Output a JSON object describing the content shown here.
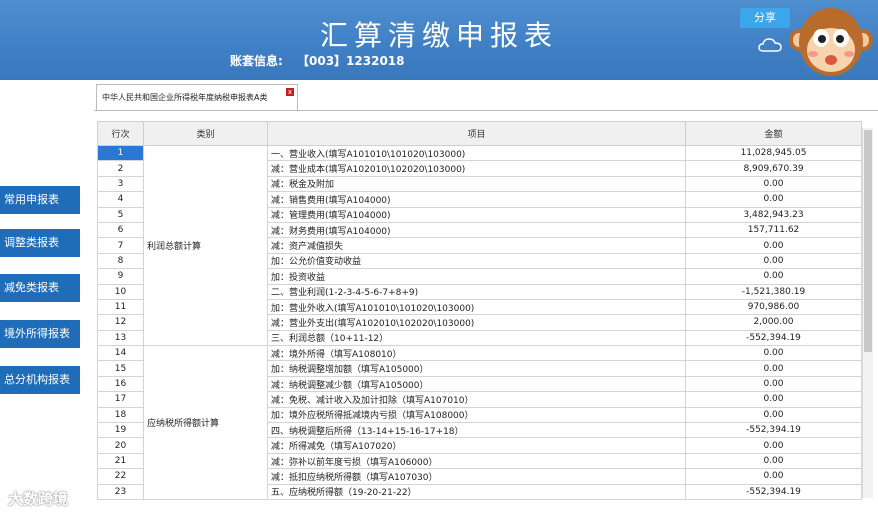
{
  "header": {
    "title": "汇算清缴申报表",
    "account_label": "账套信息:",
    "account_value": "【003】1232018",
    "share_label": "分享"
  },
  "nav": {
    "items": [
      "常用申报表",
      "调整类报表",
      "减免类报表",
      "境外所得报表",
      "总分机构报表"
    ]
  },
  "tab": {
    "label": "中华人民共和国企业所得税年度纳税申报表A类",
    "close": "x"
  },
  "table": {
    "headers": [
      "行次",
      "类别",
      "项目",
      "金额"
    ],
    "categories": [
      "利润总额计算",
      "应纳税所得额计算"
    ],
    "rows": [
      {
        "no": "1",
        "item": "一、营业收入(填写A101010\\101020\\103000)",
        "amount": "11,028,945.05"
      },
      {
        "no": "2",
        "item": "减：营业成本(填写A102010\\102020\\103000)",
        "amount": "8,909,670.39"
      },
      {
        "no": "3",
        "item": "减：税金及附加",
        "amount": "0.00"
      },
      {
        "no": "4",
        "item": "减：销售费用(填写A104000)",
        "amount": "0.00"
      },
      {
        "no": "5",
        "item": "减：管理费用(填写A104000)",
        "amount": "3,482,943.23"
      },
      {
        "no": "6",
        "item": "减：财务费用(填写A104000)",
        "amount": "157,711.62"
      },
      {
        "no": "7",
        "item": "减：资产减值损失",
        "amount": "0.00"
      },
      {
        "no": "8",
        "item": "加：公允价值变动收益",
        "amount": "0.00"
      },
      {
        "no": "9",
        "item": "加：投资收益",
        "amount": "0.00"
      },
      {
        "no": "10",
        "item": "二、营业利润(1-2-3-4-5-6-7+8+9)",
        "amount": "-1,521,380.19"
      },
      {
        "no": "11",
        "item": "加：营业外收入(填写A101010\\101020\\103000)",
        "amount": "970,986.00"
      },
      {
        "no": "12",
        "item": "减：营业外支出(填写A102010\\102020\\103000)",
        "amount": "2,000.00"
      },
      {
        "no": "13",
        "item": "三、利润总额（10+11-12）",
        "amount": "-552,394.19"
      },
      {
        "no": "14",
        "item": "减：境外所得（填写A108010）",
        "amount": "0.00"
      },
      {
        "no": "15",
        "item": "加：纳税调整增加额（填写A105000）",
        "amount": "0.00"
      },
      {
        "no": "16",
        "item": "减：纳税调整减少额（填写A105000）",
        "amount": "0.00"
      },
      {
        "no": "17",
        "item": "减：免税、减计收入及加计扣除（填写A107010）",
        "amount": "0.00"
      },
      {
        "no": "18",
        "item": "加：境外应税所得抵减境内亏损（填写A108000）",
        "amount": "0.00"
      },
      {
        "no": "19",
        "item": "四、纳税调整后所得（13-14+15-16-17+18）",
        "amount": "-552,394.19"
      },
      {
        "no": "20",
        "item": "减：所得减免（填写A107020）",
        "amount": "0.00"
      },
      {
        "no": "21",
        "item": "减：弥补以前年度亏损（填写A106000）",
        "amount": "0.00"
      },
      {
        "no": "22",
        "item": "减：抵扣应纳税所得额（填写A107030）",
        "amount": "0.00"
      },
      {
        "no": "23",
        "item": "五、应纳税所得额（19-20-21-22）",
        "amount": "-552,394.19"
      }
    ]
  },
  "watermark": "大数跨境",
  "colors": {
    "header": "#3f7fc4",
    "nav": "#1f6db8",
    "selected": "#2b78d4",
    "share": "#3ba7ea"
  }
}
